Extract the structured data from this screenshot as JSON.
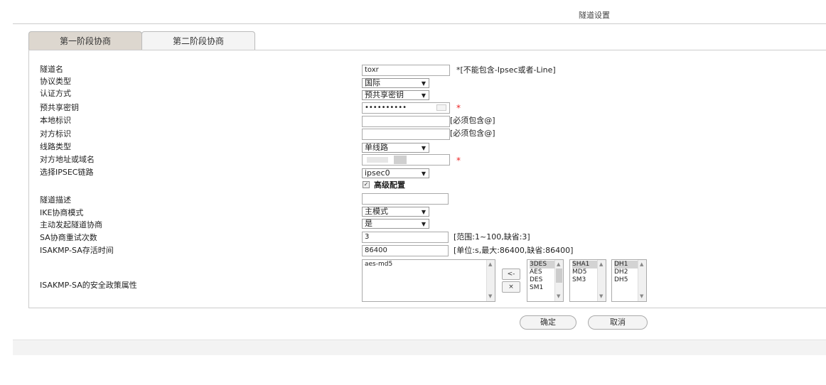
{
  "header": {
    "title": "隧道设置"
  },
  "tabs": [
    {
      "label": "第一阶段协商"
    },
    {
      "label": "第二阶段协商"
    }
  ],
  "labels": [
    "隧道名",
    "协议类型",
    "认证方式",
    "预共享密钥",
    "本地标识",
    "对方标识",
    "线路类型",
    "对方地址或域名",
    "选择IPSEC链路",
    "隧道描述",
    "IKE协商模式",
    "主动发起隧道协商",
    "SA协商重试次数",
    "ISAKMP-SA存活时间",
    "ISAKMP-SA的安全政策属性"
  ],
  "fields": {
    "tunnel_name": "toxr",
    "protocol_type": "国际",
    "auth_method": "预共享密钥",
    "psk": "••••••••••",
    "link_type": "单线路",
    "ipsec_link": "ipsec0",
    "advanced": "高级配置",
    "ike_mode": "主模式",
    "initiate": "是",
    "retry": "3",
    "lifetime": "86400",
    "policy": "aes-md5"
  },
  "hints": {
    "name_hint": "*[不能包含-Ipsec或者-Line]",
    "must_at": "[必须包含@]",
    "retry_range": "[范围:1~100,缺省:3]",
    "lifetime_range": "[单位:s,最大:86400,缺省:86400]",
    "star": "*"
  },
  "lists": {
    "enc": [
      "3DES",
      "AES",
      "DES",
      "SM1"
    ],
    "hash": [
      "SHA1",
      "MD5",
      "SM3"
    ],
    "dh": [
      "DH1",
      "DH2",
      "DH5"
    ]
  },
  "transfer": {
    "add": "<-",
    "remove": "×"
  },
  "buttons": {
    "ok": "确定",
    "cancel": "取消"
  }
}
